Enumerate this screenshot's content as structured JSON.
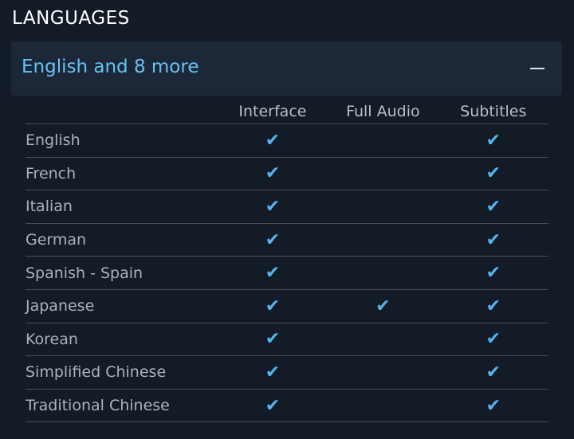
{
  "section_title": "LANGUAGES",
  "summary": "English and 8 more",
  "columns": {
    "interface": "Interface",
    "full_audio": "Full Audio",
    "subtitles": "Subtitles"
  },
  "check_glyph": "✔",
  "colors": {
    "background": "#131b26",
    "header_bg": "#1c2838",
    "accent": "#67c1f5",
    "check": "#57b3ee"
  },
  "languages": [
    {
      "name": "English",
      "interface": true,
      "full_audio": false,
      "subtitles": true
    },
    {
      "name": "French",
      "interface": true,
      "full_audio": false,
      "subtitles": true
    },
    {
      "name": "Italian",
      "interface": true,
      "full_audio": false,
      "subtitles": true
    },
    {
      "name": "German",
      "interface": true,
      "full_audio": false,
      "subtitles": true
    },
    {
      "name": "Spanish - Spain",
      "interface": true,
      "full_audio": false,
      "subtitles": true
    },
    {
      "name": "Japanese",
      "interface": true,
      "full_audio": true,
      "subtitles": true
    },
    {
      "name": "Korean",
      "interface": true,
      "full_audio": false,
      "subtitles": true
    },
    {
      "name": "Simplified Chinese",
      "interface": true,
      "full_audio": false,
      "subtitles": true
    },
    {
      "name": "Traditional Chinese",
      "interface": true,
      "full_audio": false,
      "subtitles": true
    }
  ]
}
